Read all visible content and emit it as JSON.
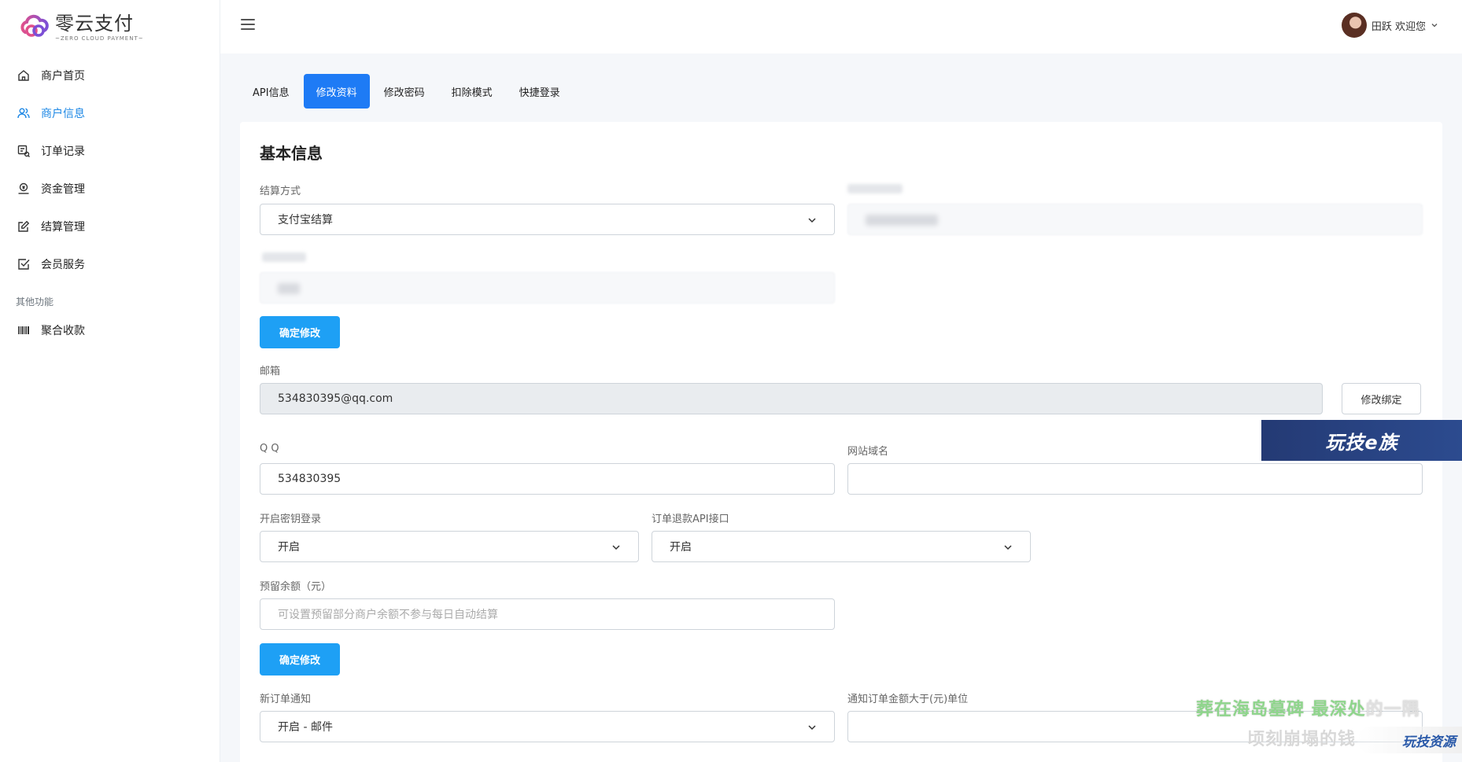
{
  "brand": {
    "title": "零云支付",
    "subtitle": "~ZERO CLOUD PAYMENT~"
  },
  "sidebar": {
    "items": [
      {
        "label": "商户首页",
        "icon": "home-icon"
      },
      {
        "label": "商户信息",
        "icon": "users-icon",
        "active": true
      },
      {
        "label": "订单记录",
        "icon": "order-icon"
      },
      {
        "label": "资金管理",
        "icon": "fund-icon"
      },
      {
        "label": "结算管理",
        "icon": "edit-icon"
      },
      {
        "label": "会员服务",
        "icon": "check-square-icon"
      }
    ],
    "section_label": "其他功能",
    "extra_items": [
      {
        "label": "聚合收款",
        "icon": "barcode-icon"
      }
    ]
  },
  "header": {
    "user_label": "田跃 欢迎您"
  },
  "tabs": [
    {
      "label": "API信息"
    },
    {
      "label": "修改资料",
      "active": true
    },
    {
      "label": "修改密码"
    },
    {
      "label": "扣除模式"
    },
    {
      "label": "快捷登录"
    }
  ],
  "form": {
    "title": "基本信息",
    "settle_method": {
      "label": "结算方式",
      "value": "支付宝结算"
    },
    "confirm_button_1": "确定修改",
    "email": {
      "label": "邮箱",
      "value": "534830395@qq.com",
      "action": "修改绑定"
    },
    "qq": {
      "label": "Q Q",
      "value": "534830395"
    },
    "site_domain": {
      "label": "网站域名",
      "value": ""
    },
    "key_login": {
      "label": "开启密钥登录",
      "value": "开启"
    },
    "refund_api": {
      "label": "订单退款API接口",
      "value": "开启"
    },
    "reserve": {
      "label": "预留余额（元）",
      "placeholder": "可设置预留部分商户余额不参与每日自动结算"
    },
    "confirm_button_2": "确定修改",
    "new_order_notify": {
      "label": "新订单通知",
      "value": "开启 - 邮件"
    },
    "notify_amount": {
      "label": "通知订单金额大于(元)单位",
      "value": ""
    }
  },
  "overlay": {
    "watermark_top": "玩技e族",
    "subtitle_line1_green": "葬在海岛墓碑 最深处",
    "subtitle_line1_rest": "的一隅",
    "subtitle_line2": "顷刻崩塌的钱",
    "watermark_bottom": "玩技资源"
  },
  "colors": {
    "primary": "#1e7bf5",
    "button": "#1ea0f5",
    "active_nav": "#1e88e5"
  }
}
